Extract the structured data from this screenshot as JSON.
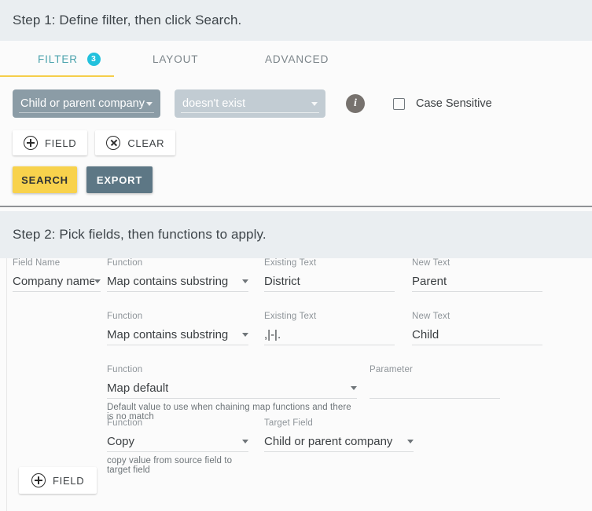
{
  "step1": {
    "title": "Step 1: Define filter, then click Search.",
    "tabs": [
      {
        "label": "FILTER",
        "badge": "3",
        "active": true
      },
      {
        "label": "LAYOUT",
        "badge": "",
        "active": false
      },
      {
        "label": "ADVANCED",
        "badge": "",
        "active": false
      }
    ],
    "filter": {
      "field_value": "Child or parent company",
      "operator_value": "doesn't exist",
      "info_icon": "info-icon",
      "case_sensitive_label": "Case Sensitive",
      "case_sensitive_checked": false
    },
    "buttons": {
      "add_field": "FIELD",
      "clear": "CLEAR",
      "search": "SEARCH",
      "export": "EXPORT"
    },
    "colors": {
      "tab_active": "#4ca3ad",
      "tab_underline": "#f5ce4a",
      "badge": "#22c1dd",
      "field_select_bg": "#8b9ca6",
      "operator_select_bg": "#c2ccd3",
      "search_bg": "#f8d24c",
      "export_bg": "#5d7785",
      "header_bg": "#eaeef1"
    }
  },
  "step2": {
    "title": "Step 2: Pick fields, then functions to apply.",
    "rows": [
      {
        "field_name_label": "Field Name",
        "field_name_value": "Company name",
        "function_label": "Function",
        "function_value": "Map contains substring",
        "existing_label": "Existing Text",
        "existing_value": "District",
        "new_label": "New Text",
        "new_value": "Parent",
        "hint": ""
      },
      {
        "function_label": "Function",
        "function_value": "Map contains substring",
        "existing_label": "Existing Text",
        "existing_value": ",|-|.",
        "new_label": "New Text",
        "new_value": "Child",
        "hint": ""
      },
      {
        "function_label": "Function",
        "function_value": "Map default",
        "parameter_label": "Parameter",
        "parameter_value": "",
        "hint": "Default value to use when chaining map functions and there is no match"
      },
      {
        "function_label": "Function",
        "function_value": "Copy",
        "target_label": "Target Field",
        "target_value": "Child or parent company",
        "hint": "copy value from source field to target field"
      }
    ],
    "add_field_button": "FIELD"
  }
}
